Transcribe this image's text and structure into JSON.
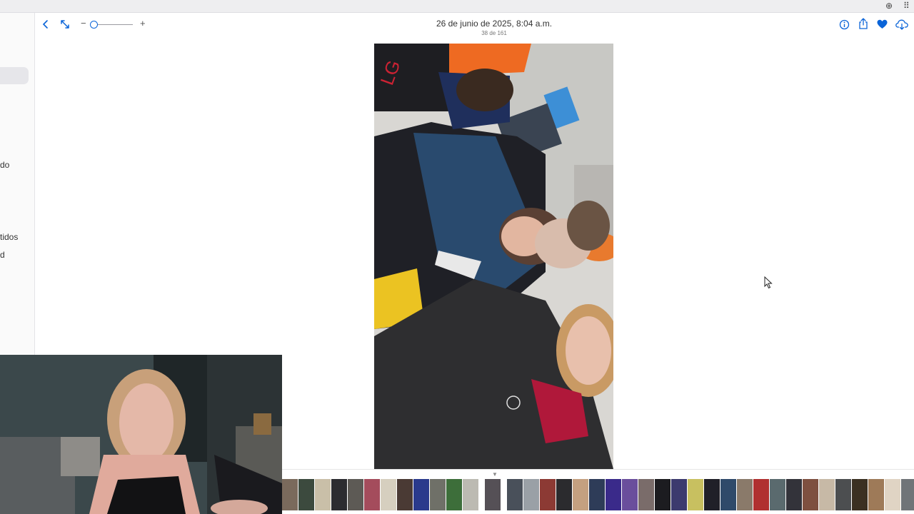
{
  "browser": {
    "add_icon": "plus-circle-icon",
    "grid_icon": "grid-dots-icon"
  },
  "sidebar": {
    "items": [
      {
        "label": "do"
      },
      {
        "label": "tidos"
      },
      {
        "label": "d"
      }
    ]
  },
  "toolbar": {
    "back_icon": "chevron-left-icon",
    "fullscreen_icon": "expand-arrows-icon",
    "zoom_out_label": "−",
    "zoom_in_label": "+",
    "info_icon": "info-icon",
    "share_icon": "share-icon",
    "favorite_icon": "heart-icon",
    "download_icon": "cloud-download-icon"
  },
  "photo_header": {
    "date_time": "26 de junio de 2025, 8:04 a.m.",
    "position": "38 de 161"
  },
  "colors": {
    "accent": "#0a64d8",
    "sidebar_bg": "#fafafa",
    "selected_bg": "#e6e6ea"
  },
  "filmstrip": {
    "thumbnails": [
      {
        "color": "#7a6a5c"
      },
      {
        "color": "#3c4a3e"
      },
      {
        "color": "#c9bfa8"
      },
      {
        "color": "#2c2c30"
      },
      {
        "color": "#5d5a55"
      },
      {
        "color": "#a44c5c"
      },
      {
        "color": "#d6cfbf"
      },
      {
        "color": "#4a3a34"
      },
      {
        "color": "#2a3a8c"
      },
      {
        "color": "#6f7068"
      },
      {
        "color": "#3d6e3a"
      },
      {
        "color": "#bcbab2"
      },
      {
        "color": "#555056",
        "current": true
      },
      {
        "color": "#49505a"
      },
      {
        "color": "#9aa0a6"
      },
      {
        "color": "#8c3a34"
      },
      {
        "color": "#2b2b2e"
      },
      {
        "color": "#c4a080"
      },
      {
        "color": "#2e3c58"
      },
      {
        "color": "#3a2a8a"
      },
      {
        "color": "#6a4e9c"
      },
      {
        "color": "#7a6c6a"
      },
      {
        "color": "#1c1c20"
      },
      {
        "color": "#3c3a6e"
      },
      {
        "color": "#c8c060"
      },
      {
        "color": "#202028"
      },
      {
        "color": "#2f4a6a"
      },
      {
        "color": "#8a7a6a"
      },
      {
        "color": "#b03030"
      },
      {
        "color": "#5a6a6e"
      },
      {
        "color": "#33333a"
      },
      {
        "color": "#7e5040"
      },
      {
        "color": "#c7b9a6"
      },
      {
        "color": "#4c4e50"
      },
      {
        "color": "#3b3022"
      },
      {
        "color": "#9e7a58"
      },
      {
        "color": "#e0d4c4"
      },
      {
        "color": "#707478"
      }
    ]
  }
}
